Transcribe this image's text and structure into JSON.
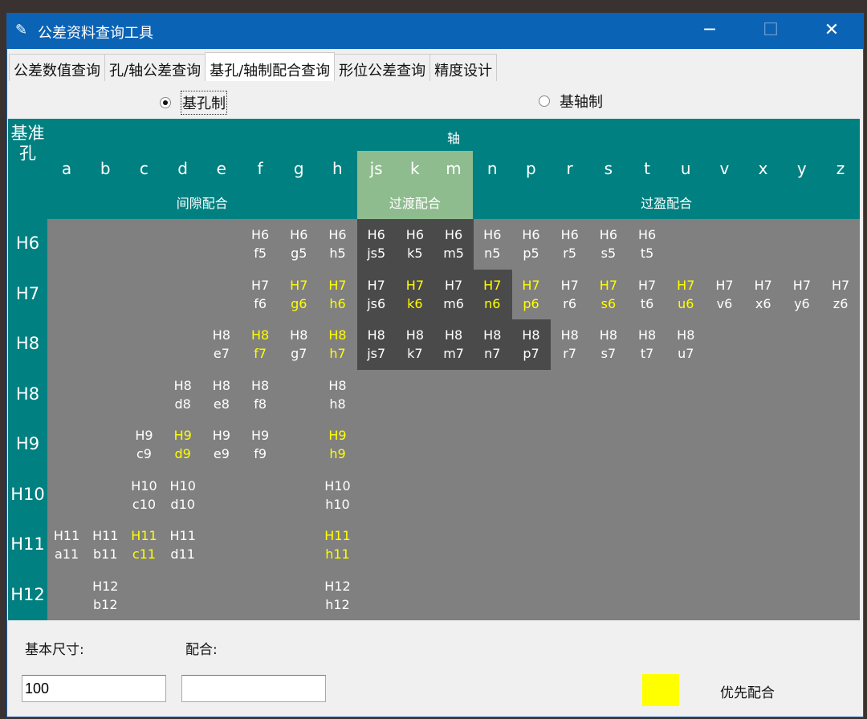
{
  "window": {
    "title": "公差资料查询工具",
    "icon": "feather-icon",
    "minimize": "─",
    "maximize": "☐",
    "close": "✕"
  },
  "tabs": [
    {
      "label": "公差数值查询"
    },
    {
      "label": "孔/轴公差查询"
    },
    {
      "label": "基孔/轴制配合查询",
      "active": true
    },
    {
      "label": "形位公差查询"
    },
    {
      "label": "精度设计"
    }
  ],
  "radios": [
    {
      "label": "基孔制",
      "selected": true
    },
    {
      "label": "基轴制",
      "selected": false
    }
  ],
  "grid": {
    "corner": "基准孔",
    "axis_label": "轴",
    "columns": [
      "a",
      "b",
      "c",
      "d",
      "e",
      "f",
      "g",
      "h",
      "js",
      "k",
      "m",
      "n",
      "p",
      "r",
      "s",
      "t",
      "u",
      "v",
      "x",
      "y",
      "z"
    ],
    "groups": [
      {
        "label": "间隙配合",
        "from": "a",
        "to": "h"
      },
      {
        "label": "过渡配合",
        "from": "js",
        "to": "m"
      },
      {
        "label": "过盈配合",
        "from": "n",
        "to": "z"
      }
    ],
    "colors": {
      "teal": "#008080",
      "transition": "#8fbc8f",
      "grid": "#808080",
      "dark": "#4a4a4a",
      "preferred": "#ffff00"
    },
    "rows": [
      {
        "hole": "H6",
        "cells": [
          {
            "c": "f",
            "t": "H6",
            "b": "f5"
          },
          {
            "c": "g",
            "t": "H6",
            "b": "g5"
          },
          {
            "c": "h",
            "t": "H6",
            "b": "h5"
          },
          {
            "c": "js",
            "t": "H6",
            "b": "js5",
            "dark": true
          },
          {
            "c": "k",
            "t": "H6",
            "b": "k5",
            "dark": true
          },
          {
            "c": "m",
            "t": "H6",
            "b": "m5",
            "dark": true
          },
          {
            "c": "n",
            "t": "H6",
            "b": "n5"
          },
          {
            "c": "p",
            "t": "H6",
            "b": "p5"
          },
          {
            "c": "r",
            "t": "H6",
            "b": "r5"
          },
          {
            "c": "s",
            "t": "H6",
            "b": "s5"
          },
          {
            "c": "t",
            "t": "H6",
            "b": "t5"
          }
        ]
      },
      {
        "hole": "H7",
        "cells": [
          {
            "c": "f",
            "t": "H7",
            "b": "f6"
          },
          {
            "c": "g",
            "t": "H7",
            "b": "g6",
            "pref": true
          },
          {
            "c": "h",
            "t": "H7",
            "b": "h6",
            "pref": true
          },
          {
            "c": "js",
            "t": "H7",
            "b": "js6",
            "dark": true
          },
          {
            "c": "k",
            "t": "H7",
            "b": "k6",
            "dark": true,
            "pref": true
          },
          {
            "c": "m",
            "t": "H7",
            "b": "m6",
            "dark": true
          },
          {
            "c": "n",
            "t": "H7",
            "b": "n6",
            "dark": true,
            "pref": true
          },
          {
            "c": "p",
            "t": "H7",
            "b": "p6",
            "pref": true
          },
          {
            "c": "r",
            "t": "H7",
            "b": "r6"
          },
          {
            "c": "s",
            "t": "H7",
            "b": "s6",
            "pref": true
          },
          {
            "c": "t",
            "t": "H7",
            "b": "t6"
          },
          {
            "c": "u",
            "t": "H7",
            "b": "u6",
            "pref": true
          },
          {
            "c": "v",
            "t": "H7",
            "b": "v6"
          },
          {
            "c": "x",
            "t": "H7",
            "b": "x6"
          },
          {
            "c": "y",
            "t": "H7",
            "b": "y6"
          },
          {
            "c": "z",
            "t": "H7",
            "b": "z6"
          }
        ]
      },
      {
        "hole": "H8",
        "cells": [
          {
            "c": "e",
            "t": "H8",
            "b": "e7"
          },
          {
            "c": "f",
            "t": "H8",
            "b": "f7",
            "pref": true
          },
          {
            "c": "g",
            "t": "H8",
            "b": "g7"
          },
          {
            "c": "h",
            "t": "H8",
            "b": "h7",
            "pref": true
          },
          {
            "c": "js",
            "t": "H8",
            "b": "js7",
            "dark": true
          },
          {
            "c": "k",
            "t": "H8",
            "b": "k7",
            "dark": true
          },
          {
            "c": "m",
            "t": "H8",
            "b": "m7",
            "dark": true
          },
          {
            "c": "n",
            "t": "H8",
            "b": "n7",
            "dark": true
          },
          {
            "c": "p",
            "t": "H8",
            "b": "p7",
            "dark": true
          },
          {
            "c": "r",
            "t": "H8",
            "b": "r7"
          },
          {
            "c": "s",
            "t": "H8",
            "b": "s7"
          },
          {
            "c": "t",
            "t": "H8",
            "b": "t7"
          },
          {
            "c": "u",
            "t": "H8",
            "b": "u7"
          }
        ]
      },
      {
        "hole": "H8",
        "cells": [
          {
            "c": "d",
            "t": "H8",
            "b": "d8"
          },
          {
            "c": "e",
            "t": "H8",
            "b": "e8"
          },
          {
            "c": "f",
            "t": "H8",
            "b": "f8"
          },
          {
            "c": "h",
            "t": "H8",
            "b": "h8"
          }
        ]
      },
      {
        "hole": "H9",
        "cells": [
          {
            "c": "c",
            "t": "H9",
            "b": "c9"
          },
          {
            "c": "d",
            "t": "H9",
            "b": "d9",
            "pref": true
          },
          {
            "c": "e",
            "t": "H9",
            "b": "e9"
          },
          {
            "c": "f",
            "t": "H9",
            "b": "f9"
          },
          {
            "c": "h",
            "t": "H9",
            "b": "h9",
            "pref": true
          }
        ]
      },
      {
        "hole": "H10",
        "cells": [
          {
            "c": "c",
            "t": "H10",
            "b": "c10"
          },
          {
            "c": "d",
            "t": "H10",
            "b": "d10"
          },
          {
            "c": "h",
            "t": "H10",
            "b": "h10"
          }
        ]
      },
      {
        "hole": "H11",
        "cells": [
          {
            "c": "a",
            "t": "H11",
            "b": "a11"
          },
          {
            "c": "b",
            "t": "H11",
            "b": "b11"
          },
          {
            "c": "c",
            "t": "H11",
            "b": "c11",
            "pref": true
          },
          {
            "c": "d",
            "t": "H11",
            "b": "d11"
          },
          {
            "c": "h",
            "t": "H11",
            "b": "h11",
            "pref": true
          }
        ]
      },
      {
        "hole": "H12",
        "cells": [
          {
            "c": "b",
            "t": "H12",
            "b": "b12"
          },
          {
            "c": "h",
            "t": "H12",
            "b": "h12"
          }
        ]
      }
    ]
  },
  "bottom": {
    "size_label": "基本尺寸:",
    "size_value": "100",
    "fit_label": "配合:",
    "fit_value": "",
    "legend_label": "优先配合",
    "legend_color": "#ffff00"
  }
}
